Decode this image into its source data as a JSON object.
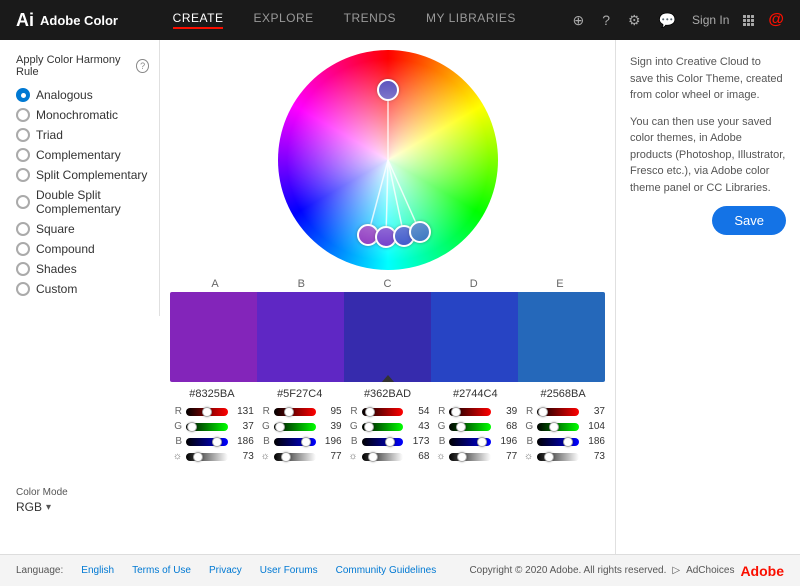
{
  "app": {
    "name": "Adobe Color",
    "logo_text": "Adobe Color"
  },
  "header": {
    "nav": [
      {
        "label": "CREATE",
        "active": true
      },
      {
        "label": "EXPLORE",
        "active": false
      },
      {
        "label": "TRENDS",
        "active": false
      },
      {
        "label": "MY LIBRARIES",
        "active": false
      }
    ],
    "sign_in": "Sign In"
  },
  "left_panel": {
    "section_label": "Apply Color Harmony Rule",
    "rules": [
      {
        "label": "Analogous",
        "active": true
      },
      {
        "label": "Monochromatic",
        "active": false
      },
      {
        "label": "Triad",
        "active": false
      },
      {
        "label": "Complementary",
        "active": false
      },
      {
        "label": "Split Complementary",
        "active": false
      },
      {
        "label": "Double Split Complementary",
        "active": false
      },
      {
        "label": "Square",
        "active": false
      },
      {
        "label": "Compound",
        "active": false
      },
      {
        "label": "Shades",
        "active": false
      },
      {
        "label": "Custom",
        "active": false
      }
    ],
    "color_mode_label": "Color Mode",
    "color_mode": "RGB"
  },
  "color_strips": {
    "labels": [
      "A",
      "B",
      "C",
      "D",
      "E"
    ],
    "colors": [
      "#8325BA",
      "#5F27C4",
      "#362BAD",
      "#2744C4",
      "#2568BA"
    ],
    "hex_values": [
      "#8325BA",
      "#5F27C4",
      "#362BAD",
      "#2744C4",
      "#2568BA"
    ]
  },
  "sliders": {
    "columns": [
      {
        "hex": "#8325BA",
        "R": {
          "value": 131,
          "pct": 51
        },
        "G": {
          "value": 37,
          "pct": 14
        },
        "B": {
          "value": 186,
          "pct": 73
        },
        "brightness": {
          "value": 73,
          "pct": 28
        }
      },
      {
        "hex": "#5F27C4",
        "R": {
          "value": 95,
          "pct": 37
        },
        "G": {
          "value": 39,
          "pct": 15
        },
        "B": {
          "value": 196,
          "pct": 77
        },
        "brightness": {
          "value": 77,
          "pct": 30
        }
      },
      {
        "hex": "#362BAD",
        "R": {
          "value": 54,
          "pct": 21
        },
        "G": {
          "value": 43,
          "pct": 17
        },
        "B": {
          "value": 173,
          "pct": 68
        },
        "brightness": {
          "value": 68,
          "pct": 27
        }
      },
      {
        "hex": "#2744C4",
        "R": {
          "value": 39,
          "pct": 15
        },
        "G": {
          "value": 68,
          "pct": 27
        },
        "B": {
          "value": 196,
          "pct": 77
        },
        "brightness": {
          "value": 77,
          "pct": 30
        }
      },
      {
        "hex": "#2568BA",
        "R": {
          "value": 37,
          "pct": 15
        },
        "G": {
          "value": 104,
          "pct": 41
        },
        "B": {
          "value": 186,
          "pct": 73
        },
        "brightness": {
          "value": 73,
          "pct": 28
        }
      }
    ]
  },
  "right_panel": {
    "info1": "Sign into Creative Cloud to save this Color Theme, created from color wheel or image.",
    "info2": "You can then use your saved color themes, in Adobe products (Photoshop, Illustrator, Fresco etc.), via Adobe color theme panel or CC Libraries.",
    "save_label": "Save"
  },
  "footer": {
    "language_label": "Language:",
    "language": "English",
    "links": [
      "Terms of Use",
      "Privacy",
      "User Forums",
      "Community Guidelines"
    ],
    "copyright": "Copyright © 2020 Adobe. All rights reserved.",
    "ad_choices": "AdChoices",
    "adobe": "Adobe"
  }
}
